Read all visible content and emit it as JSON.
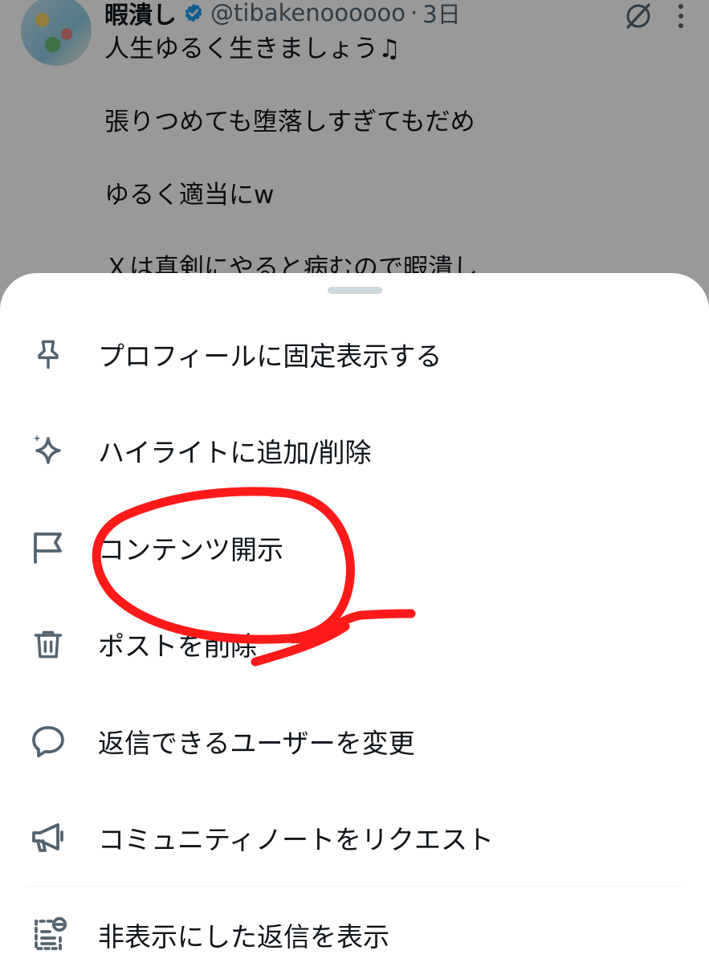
{
  "post": {
    "display_name": "暇潰し",
    "handle": "@tibakenoooooo",
    "separator": "·",
    "time_ago": "3日",
    "lines": [
      "人生ゆるく生きましょう♫",
      "張りつめても堕落しすぎてもだめ",
      "ゆるく適当にw",
      "Ｘは真剣にやると病むので暇潰し"
    ]
  },
  "sheet": {
    "items": [
      {
        "label": "プロフィールに固定表示する",
        "icon": "pin-icon"
      },
      {
        "label": "ハイライトに追加/削除",
        "icon": "sparkle-icon"
      },
      {
        "label": "コンテンツ開示",
        "icon": "flag-icon"
      },
      {
        "label": "ポストを削除",
        "icon": "trash-icon"
      },
      {
        "label": "返信できるユーザーを変更",
        "icon": "speech-bubble-icon"
      },
      {
        "label": "コミュニティノートをリクエスト",
        "icon": "megaphone-icon"
      },
      {
        "label": "非表示にした返信を表示",
        "icon": "hidden-replies-icon"
      }
    ]
  },
  "colors": {
    "text": "#0f1419",
    "secondary_text": "#536471",
    "verified_blue": "#1d9bf0",
    "annotation_red": "#ff1a1a",
    "scrim": "rgba(0,0,0,0.40)"
  }
}
